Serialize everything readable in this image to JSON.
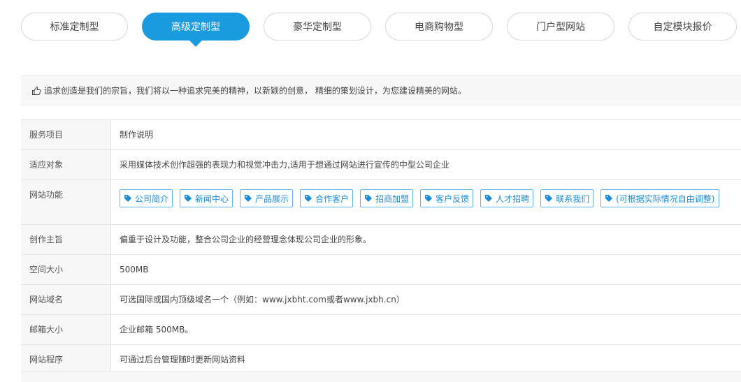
{
  "tabs": [
    {
      "label": "标准定制型",
      "active": false
    },
    {
      "label": "高级定制型",
      "active": true
    },
    {
      "label": "豪华定制型",
      "active": false
    },
    {
      "label": "电商购物型",
      "active": false
    },
    {
      "label": "门户型网站",
      "active": false
    },
    {
      "label": "自定模块报价",
      "active": false
    }
  ],
  "notice": {
    "icon": "thumbs-up-icon",
    "text": "追求创造是我们的宗旨，我们将以一种追求完美的精神，以新颖的创意， 精细的策划设计，为您建设精美的网站。"
  },
  "table": {
    "header": {
      "key": "服务项目",
      "value": "制作说明"
    },
    "rows": [
      {
        "key": "适应对象",
        "value": "采用媒体技术创作超强的表现力和视觉冲击力,适用于想通过网站进行宣传的中型公司企业"
      },
      {
        "key": "网站功能",
        "tags": [
          "公司简介",
          "新闻中心",
          "产品展示",
          "合作客户",
          "招商加盟",
          "客户反馈",
          "人才招聘",
          "联系我们",
          "(可根据实际情况自由调整)"
        ]
      },
      {
        "key": "创作主旨",
        "value": "偏重于设计及功能，整合公司企业的经营理念体现公司企业的形象。"
      },
      {
        "key": "空间大小",
        "value": "500MB"
      },
      {
        "key": "网站域名",
        "value": "可选国际或国内顶级域名一个（例如：www.jxbht.com或者www.jxbh.cn）"
      },
      {
        "key": "邮箱大小",
        "value": "企业邮箱 500MB。"
      },
      {
        "key": "网站程序",
        "value": "可通过后台管理随时更新网站资料"
      }
    ]
  },
  "colors": {
    "accent": "#1a9be0",
    "tag_border": "#5fb4e5",
    "tag_text": "#1a8ad8"
  }
}
